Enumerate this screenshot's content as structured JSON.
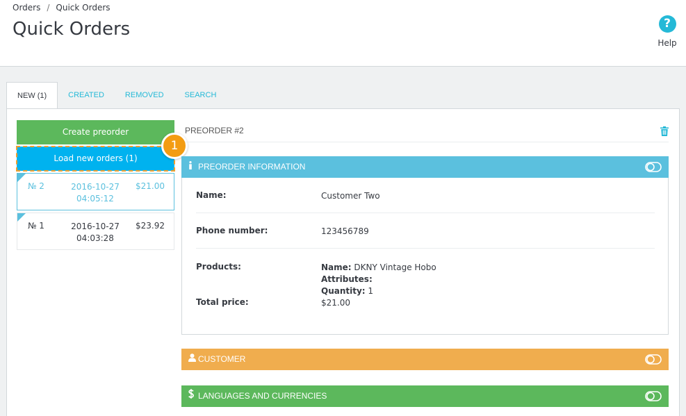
{
  "breadcrumb": {
    "parent": "Orders",
    "separator": "/",
    "current": "Quick Orders"
  },
  "page_title": "Quick Orders",
  "help": {
    "label": "Help",
    "glyph": "?"
  },
  "tabs": [
    {
      "label": "NEW (1)",
      "active": true
    },
    {
      "label": "CREATED"
    },
    {
      "label": "REMOVED"
    },
    {
      "label": "SEARCH"
    }
  ],
  "actions": {
    "create_label": "Create preorder",
    "load_label": "Load new orders (1)"
  },
  "step_badge": "1",
  "orders": [
    {
      "number": "№ 2",
      "date": "2016-10-27",
      "time": "04:05:12",
      "price": "$21.00",
      "selected": true
    },
    {
      "number": "№ 1",
      "date": "2016-10-27",
      "time": "04:03:28",
      "price": "$23.92"
    }
  ],
  "preorder": {
    "title": "PREORDER #2",
    "sections": {
      "info_title": "PREORDER INFORMATION",
      "customer_title": "CUSTOMER",
      "languages_title": "LANGUAGES AND CURRENCIES"
    },
    "info": {
      "name_label": "Name:",
      "name_value": "Customer Two",
      "phone_label": "Phone number:",
      "phone_value": "123456789",
      "products_label": "Products:",
      "product_name_label": "Name:",
      "product_name_value": "DKNY Vintage Hobo",
      "attributes_label": "Attributes:",
      "quantity_label": "Quantity:",
      "quantity_value": "1",
      "total_label": "Total price:",
      "total_value": "$21.00"
    }
  },
  "colors": {
    "accent": "#25b9d7",
    "info_bar": "#5bc0de",
    "customer_bar": "#f0ad4e",
    "languages_bar": "#5cb85c",
    "create_button": "#5cb85c",
    "load_button": "#00b2ef",
    "step_badge": "#f39c12"
  },
  "icons": {
    "help": "help-icon",
    "trash": "trash-icon",
    "info": "info-icon",
    "user": "user-icon",
    "dollar": "dollar-icon",
    "toggle": "toggle-icon"
  }
}
